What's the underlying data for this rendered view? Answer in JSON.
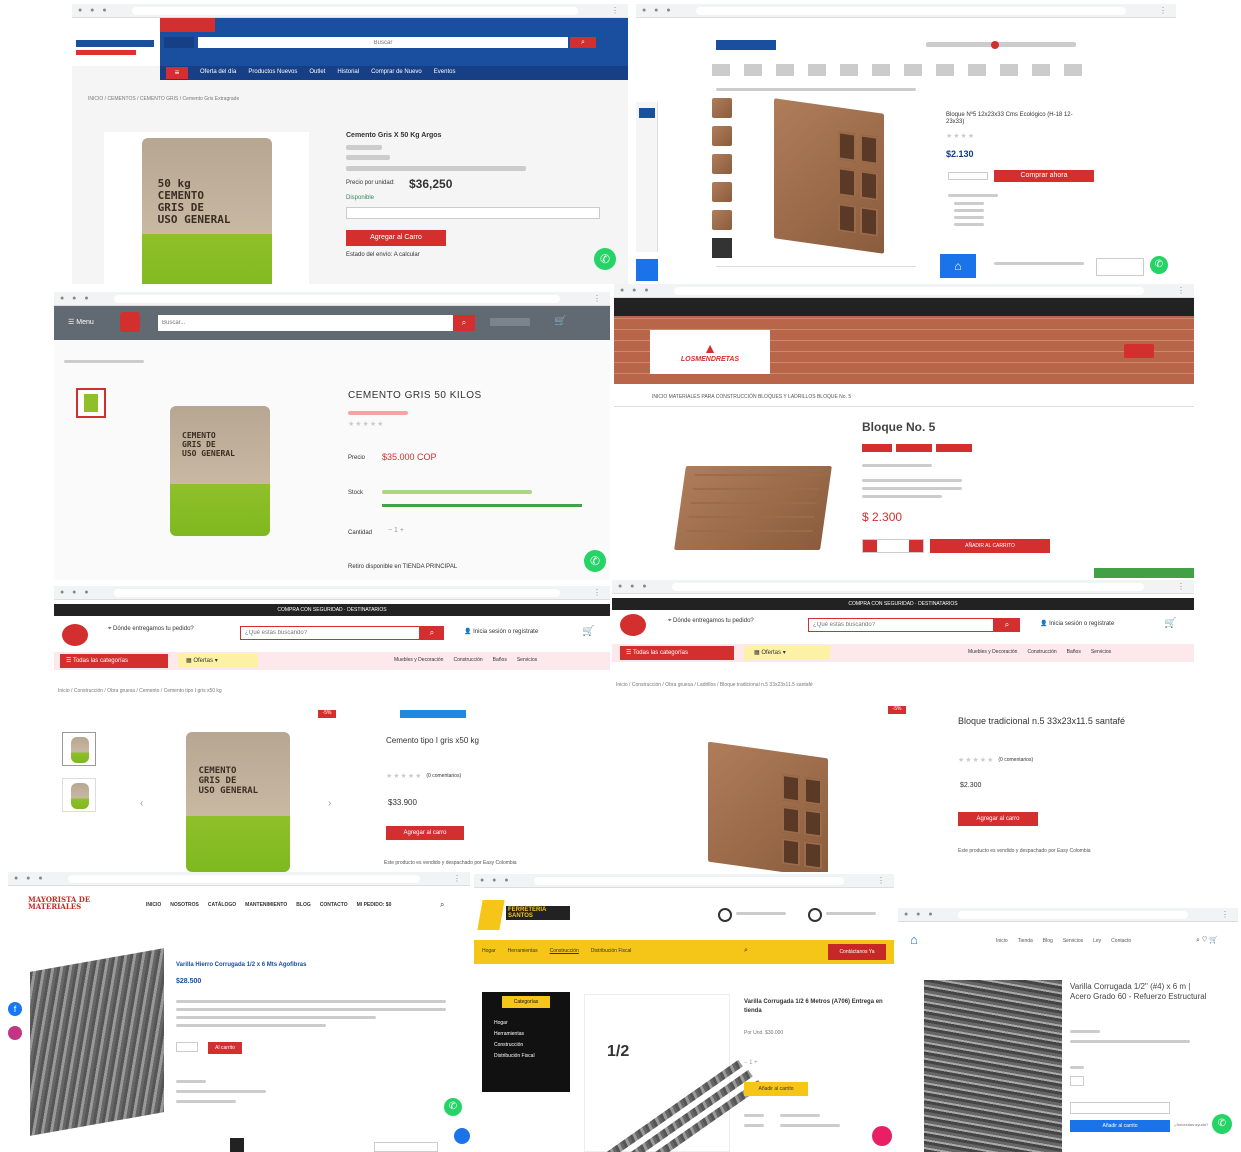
{
  "p1": {
    "search_placeholder": "Buscar",
    "nav": [
      "Oferta del día",
      "Productos Nuevos",
      "Outlet",
      "Historial",
      "Comprar de Nuevo",
      "Eventos"
    ],
    "breadcrumb": "INICIO / CEMENTOS / CEMENTO GRIS / Cemento Gris Extragrade",
    "bag_text": "50 kg\nCEMENTO\nGRIS DE\nUSO GENERAL",
    "title": "Cemento Gris X 50 Kg Argos",
    "price_label": "Precio por unidad:",
    "price": "$36,250",
    "availability": "Disponible",
    "add_button": "Agregar al Carro",
    "status": "Estado del envío: A calcular"
  },
  "p2": {
    "title": "Bloque Nº5 12x23x33 Cms Ecológico (H-18 12-23x33)",
    "price": "$2.130",
    "buy_button": "Comprar ahora"
  },
  "p3": {
    "menu": "Menu",
    "search_placeholder": "Buscar...",
    "title": "CEMENTO GRIS 50 KILOS",
    "price_label": "Precio",
    "price": "$35.000 COP",
    "stock_label": "Stock",
    "quantity_label": "Cantidad",
    "store_note": "Retiro disponible en TIENDA PRINCIPAL"
  },
  "p4": {
    "logo_text": "LOSMENDRETAS",
    "breadcrumb": "INICIO  MATERIALES PARA CONSTRUCCIÓN  BLOQUES Y LADRILLOS  BLOQUE No. 5",
    "title": "Bloque No. 5",
    "price": "$ 2.300",
    "add_button": "AÑADIR AL CARRITO"
  },
  "p5": {
    "top_bar": "COMPRA CON SEGURIDAD · DESTINATARIOS",
    "location_label": "Dónde entregamos tu pedido?",
    "search_placeholder": "¿Qué estás buscando?",
    "account_label": "Inicia sesión o regístrate",
    "categories": "Todas las categorías",
    "offers": "Ofertas",
    "nav": [
      "Muebles y Decoración",
      "Construcción",
      "Baños",
      "Servicios"
    ],
    "breadcrumb": "Inicio / Construcción / Obra gruesa / Cemento / Cemento tipo I gris x50 kg",
    "badge": "-5%",
    "title": "Cemento tipo I gris x50 kg",
    "reviews": "(0 comentarios)",
    "price": "$33.900",
    "add_button": "Agregar al carro",
    "note": "Este producto es vendido y despachado por Easy Colombia"
  },
  "p6": {
    "top_bar": "COMPRA CON SEGURIDAD · DESTINATARIOS",
    "location_label": "Dónde entregamos tu pedido?",
    "search_placeholder": "¿Qué estás buscando?",
    "account_label": "Inicia sesión o regístrate",
    "categories": "Todas las categorías",
    "offers": "Ofertas",
    "nav": [
      "Muebles y Decoración",
      "Construcción",
      "Baños",
      "Servicios"
    ],
    "breadcrumb": "Inicio / Construcción / Obra gruesa / Ladrillos / Bloque tradicional n.5 33x23x11.5 santafé",
    "badge": "-5%",
    "title": "Bloque tradicional n.5 33x23x11.5 santafé",
    "reviews": "(0 comentarios)",
    "price": "$2.300",
    "add_button": "Agregar al carro",
    "note": "Este producto es vendido y despachado por Easy Colombia"
  },
  "p7": {
    "logo": "MAYORISTA DE MATERIALES",
    "nav": [
      "INICIO",
      "NOSOTROS",
      "CATÁLOGO",
      "MANTENIMIENTO",
      "BLOG",
      "CONTACTO",
      "MI PEDIDO: $0"
    ],
    "title": "Varilla Hierro Corrugada 1/2 x 6 Mts Agofibras",
    "price": "$28.500",
    "add_button": "Al carrito"
  },
  "p8": {
    "logo": "FERRETERÍA SANTOS",
    "menu": [
      "Hogar",
      "Herramientas",
      "Construcción",
      "Distribución Fiscal"
    ],
    "contact_button": "Contáctanos Ya",
    "sidebar_title": "Categorías",
    "sidebar_items": [
      "Hogar",
      "Herramientas",
      "Construcción",
      "Distribución Fiscal"
    ],
    "bar_label": "1/2",
    "title": "Varilla Corrugada 1/2 6 Metros (A706) Entrega en tienda",
    "price": "Por Und. $30.000",
    "buy_button": "Añadir al carrito"
  },
  "p9": {
    "nav": [
      "Inicio",
      "Tienda",
      "Blog",
      "Servicios",
      "Ley",
      "Contacto"
    ],
    "title": "Varilla Corrugada 1/2\" (#4) x 6 m | Acero Grado 60 - Refuerzo Estructural",
    "button": "Añadir al carrito",
    "chat": "¿Necesitas ayuda?"
  }
}
